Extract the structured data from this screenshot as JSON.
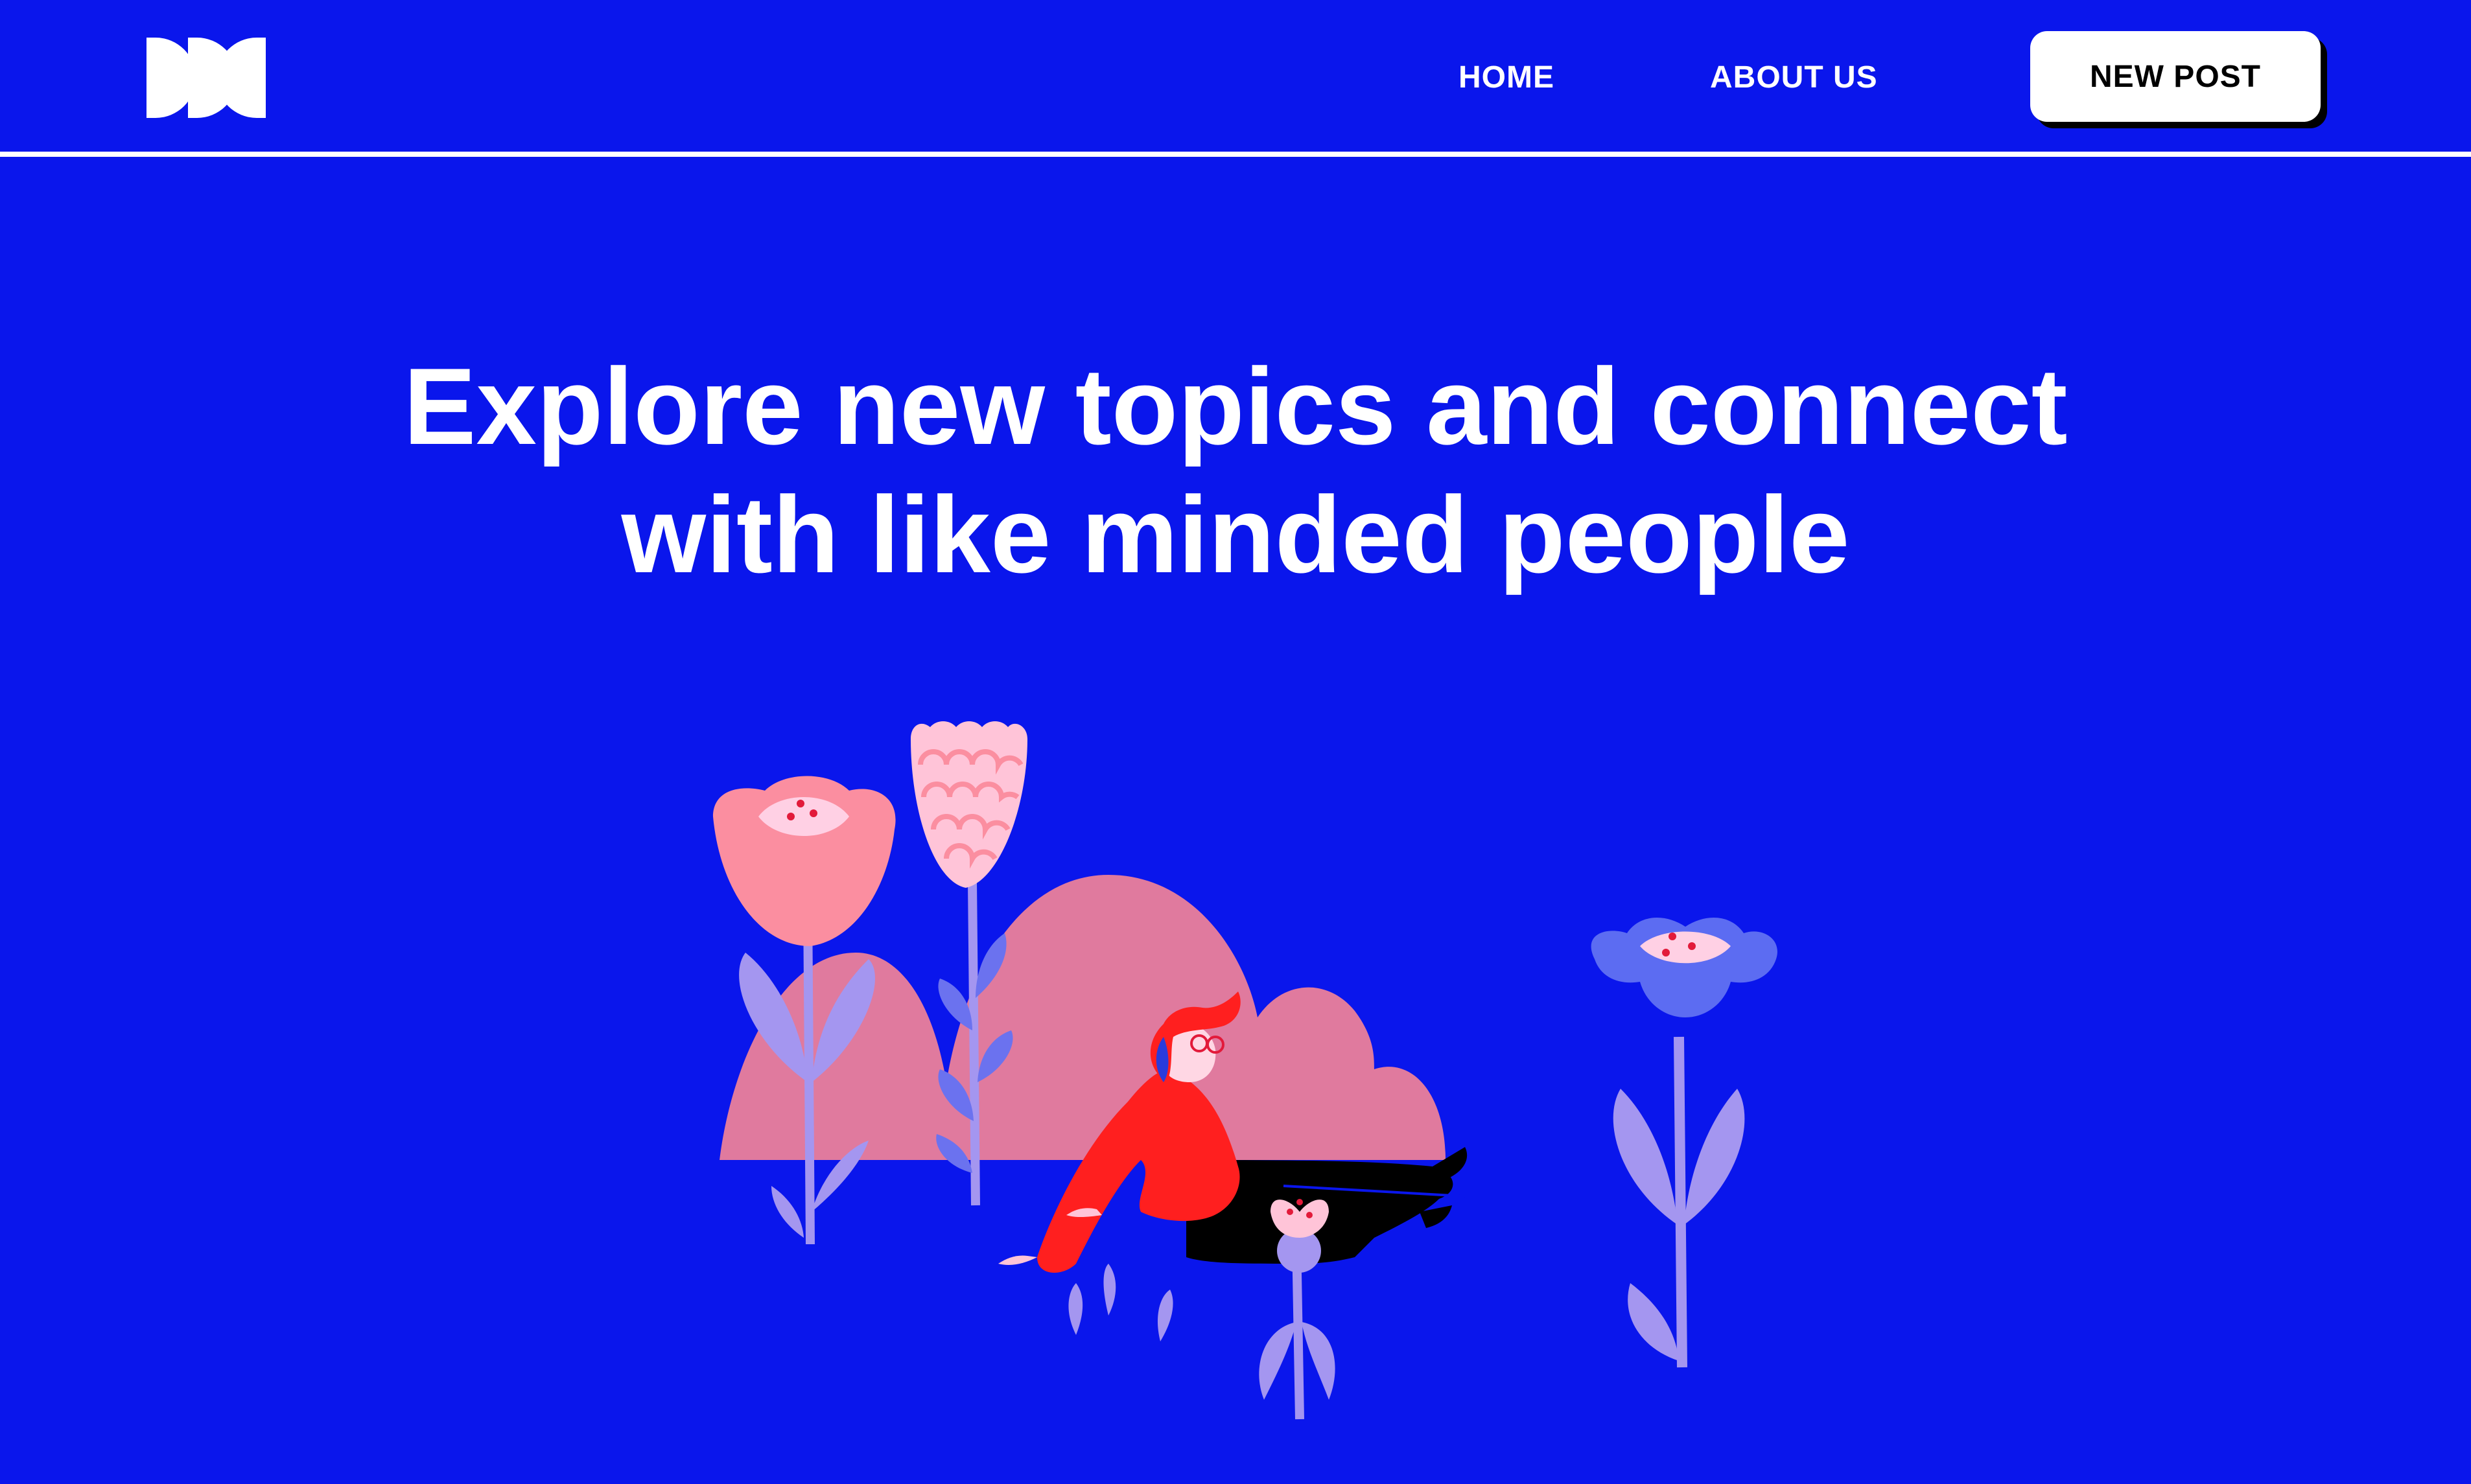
{
  "header": {
    "logo_icon": "ddc-logo-icon",
    "nav": {
      "home_label": "HOME",
      "about_label": "ABOUT US"
    },
    "new_post_label": "NEW POST"
  },
  "hero": {
    "title_line_1": "Explore new topics and connect",
    "title_line_2": "with like minded people",
    "illustration_icon": "person-relaxing-in-flowers-illustration"
  },
  "colors": {
    "background": "#0a16ec",
    "text": "#ffffff",
    "button_bg": "#ffffff",
    "button_text": "#000000",
    "pink_hill": "#e07a9e",
    "coral_flower": "#fb8ea0",
    "lilac": "#a496f0",
    "person_red": "#ff1f1f"
  }
}
